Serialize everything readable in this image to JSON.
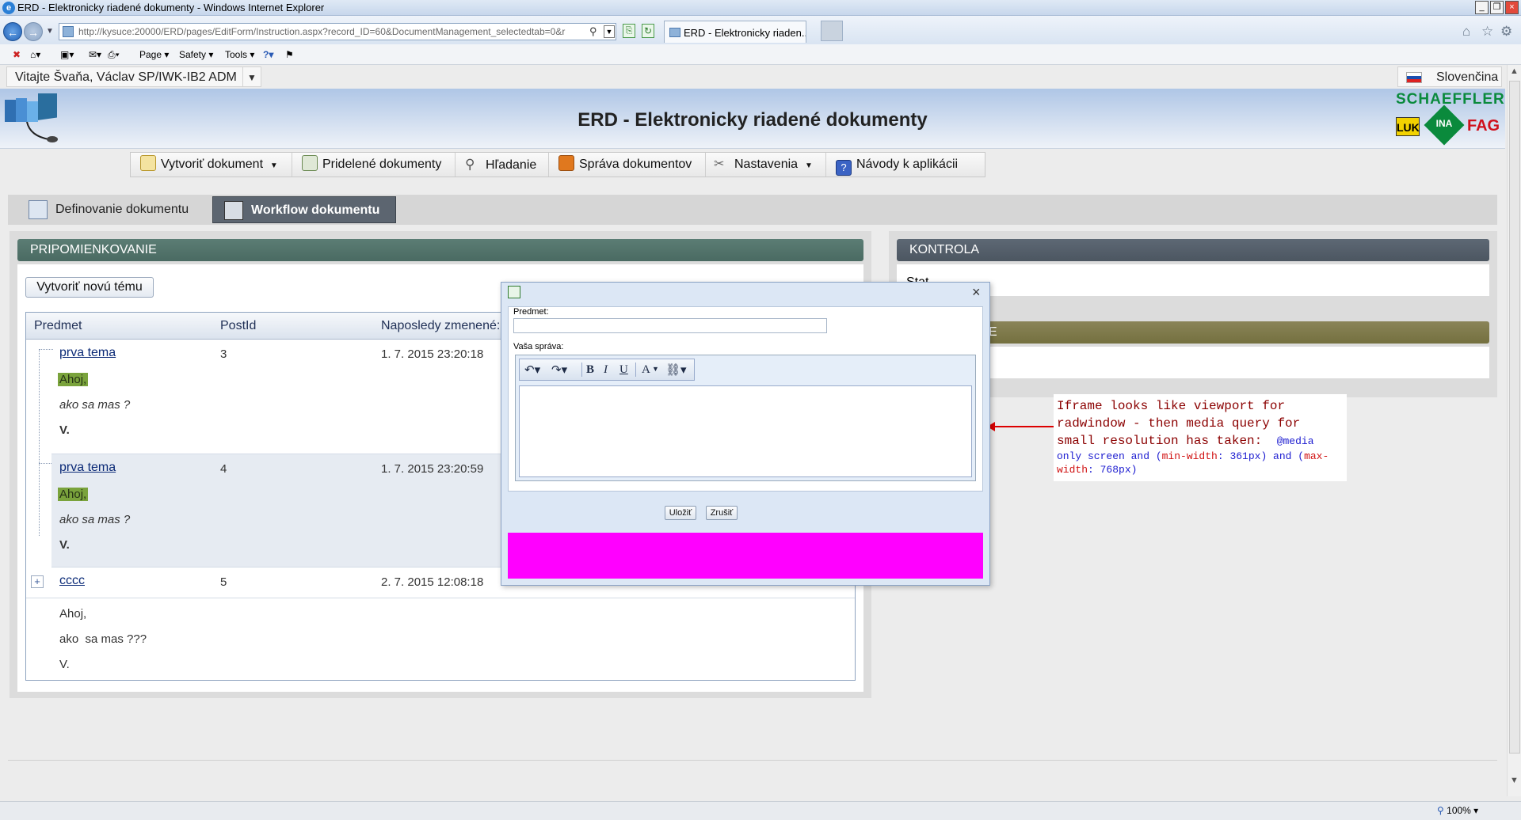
{
  "window": {
    "title": "ERD - Elektronicky riadené dokumenty - Windows Internet Explorer",
    "url": "http://kysuce:20000/ERD/pages/EditForm/Instruction.aspx?record_ID=60&DocumentManagement_selectedtab=0&r",
    "tab_label": "ERD - Elektronicky riaden...",
    "commands": [
      "Page",
      "Safety",
      "Tools"
    ]
  },
  "header": {
    "welcome": "Vitajte Švaňa, Václav SP/IWK-IB2 ADM",
    "language": "Slovenčina",
    "app_title": "ERD - Elektronicky riadené dokumenty",
    "brand": "SCHAEFFLER",
    "brand_luk": "LUK",
    "brand_ina": "INA",
    "brand_fag": "FAG"
  },
  "menu": {
    "items": [
      {
        "label": "Vytvoriť dokument",
        "dropdown": true
      },
      {
        "label": "Pridelené dokumenty"
      },
      {
        "label": "Hľadanie"
      },
      {
        "label": "Správa dokumentov"
      },
      {
        "label": "Nastavenia",
        "dropdown": true
      },
      {
        "label": "Návody k aplikácii"
      }
    ]
  },
  "tabs": {
    "definovanie": "Definovanie dokumentu",
    "workflow": "Workflow dokumentu"
  },
  "left_panel": {
    "header": "PRIPOMIENKOVANIE",
    "new_topic": "Vytvoriť novú tému",
    "columns": [
      "Predmet",
      "PostId",
      "Naposledy zmenené:"
    ],
    "rows": [
      {
        "subject": "prva tema",
        "post_id": "3",
        "date": "1. 7. 2015 23:20:18",
        "line1": "Ahoj,",
        "line2": "ako sa mas ?",
        "line3": "V."
      },
      {
        "subject": "prva tema",
        "post_id": "4",
        "date": "1. 7. 2015 23:20:59",
        "line1": "Ahoj,",
        "line2": "ako sa mas ?",
        "line3": "V."
      },
      {
        "subject": "cccc",
        "post_id": "5",
        "date": "2. 7. 2015 12:08:18",
        "line1": "Ahoj,",
        "line2": "ako  sa mas ???",
        "line3": "V."
      }
    ]
  },
  "right_panel": {
    "header1": "KONTROLA",
    "body1": "Stat",
    "header2": "NIE"
  },
  "annotation": {
    "line1": "Iframe looks like viewport for",
    "line2": "radwindow - then media query for",
    "line3": "small resolution has taken:",
    "code_a": "@media",
    "code_b": "only screen and (",
    "code_c": "min-width",
    "code_d": ": 361px) and (",
    "code_e": "max-",
    "code_f": "width",
    "code_g": ": 768px)"
  },
  "dialog": {
    "subject_label": "Predmet:",
    "subject_value": "",
    "message_label": "Vaša správa:",
    "save": "Uložiť",
    "cancel": "Zrušiť",
    "toolbar": [
      "undo-icon",
      "redo-icon",
      "bold",
      "italic",
      "underline",
      "font-color",
      "link"
    ],
    "bold": "B",
    "italic": "I",
    "underline": "U",
    "fontcolor": "A"
  },
  "status": {
    "zoom": "100%"
  },
  "colors": {
    "green_header": "#4a6a62",
    "gray_header": "#4c5661",
    "olive_header": "#74703f",
    "magenta": "#ff00ff",
    "highlight": "#7aa33c"
  }
}
